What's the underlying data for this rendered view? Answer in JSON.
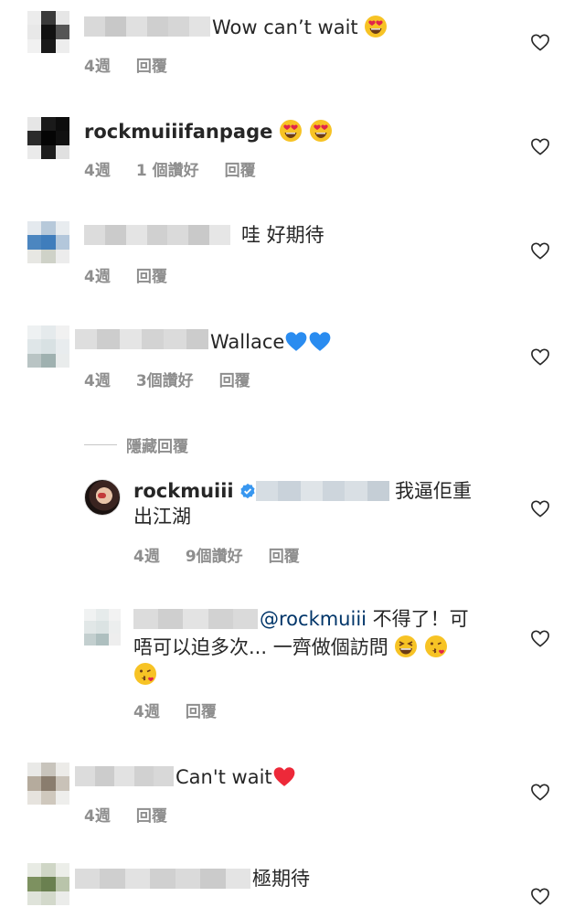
{
  "comments": [
    {
      "text": "Wow can’t wait",
      "time": "4週",
      "reply": "回覆"
    },
    {
      "username": "rockmuiiifanpage",
      "time": "4週",
      "likes": "1 個讚好",
      "reply": "回覆"
    },
    {
      "text": "哇 好期待",
      "time": "4週",
      "reply": "回覆"
    },
    {
      "text": "Wallace",
      "time": "4週",
      "likes": "3個讚好",
      "reply": "回覆"
    }
  ],
  "hide_replies": "隱藏回覆",
  "replies": [
    {
      "username": "rockmuiii",
      "verified": true,
      "text_line1": "我逼佢重",
      "text_line2": "出江湖",
      "time": "4週",
      "likes": "9個讚好",
      "reply": "回覆"
    },
    {
      "mention": "@rockmuiii",
      "text_line1_rest": " 不得了！可",
      "text_line2": "唔可以迫多次... 一齊做個訪問",
      "time": "4週",
      "reply": "回覆"
    }
  ],
  "comments_bottom": [
    {
      "text": "Can't wait",
      "time": "4週",
      "reply": "回覆"
    },
    {
      "text": "極期待"
    }
  ],
  "colors": {
    "meta": "#8e8e8e",
    "mention": "#003569",
    "verified": "#3897f0",
    "heart_red": "#ed2939",
    "heart_blue": "#2a8cf0"
  },
  "icons": [
    "heart-outline-icon",
    "verified-badge-icon",
    "heart-eyes-emoji",
    "grinning-squint-emoji",
    "kissing-heart-emoji",
    "blue-heart-emoji",
    "red-heart-emoji"
  ]
}
